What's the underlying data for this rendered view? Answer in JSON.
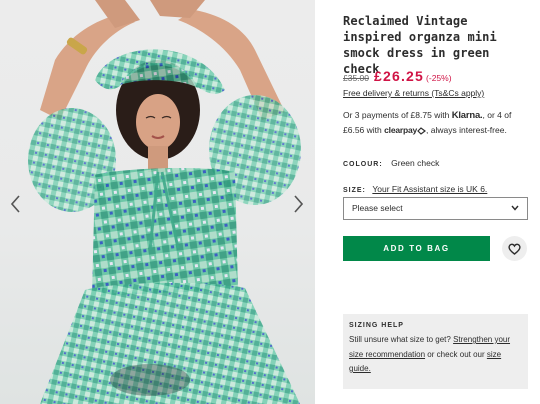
{
  "gallery": {
    "prev_icon": "chevron-left-icon",
    "next_icon": "chevron-right-icon"
  },
  "product": {
    "title": "Reclaimed Vintage inspired organza mini smock dress in green check",
    "price_was": "£35.00",
    "price_now": "£26.25",
    "price_discount": "(-25%)",
    "sale_color": "#d01345",
    "delivery_link": "Free delivery & returns (Ts&Cs apply)"
  },
  "payment": {
    "prefix": "Or 3 payments of £8.75 with",
    "klarna": "Klarna.",
    "middle": ", or 4 of £6.56 with",
    "clearpay": "clearpay",
    "suffix": ", always interest-free."
  },
  "colour": {
    "label": "COLOUR:",
    "value": "Green check"
  },
  "size": {
    "label": "SIZE:",
    "fit_assistant": "Your Fit Assistant size is UK 6.",
    "select_value": "Please select"
  },
  "actions": {
    "add_to_bag": "ADD TO BAG",
    "add_color": "#018849",
    "wishlist_icon": "heart-icon"
  },
  "sizing_help": {
    "heading": "SIZING HELP",
    "text_1": "Still unsure what size to get?",
    "link_1": "Strengthen your size recommendation",
    "text_2": "or check out our",
    "link_2": "size guide."
  }
}
